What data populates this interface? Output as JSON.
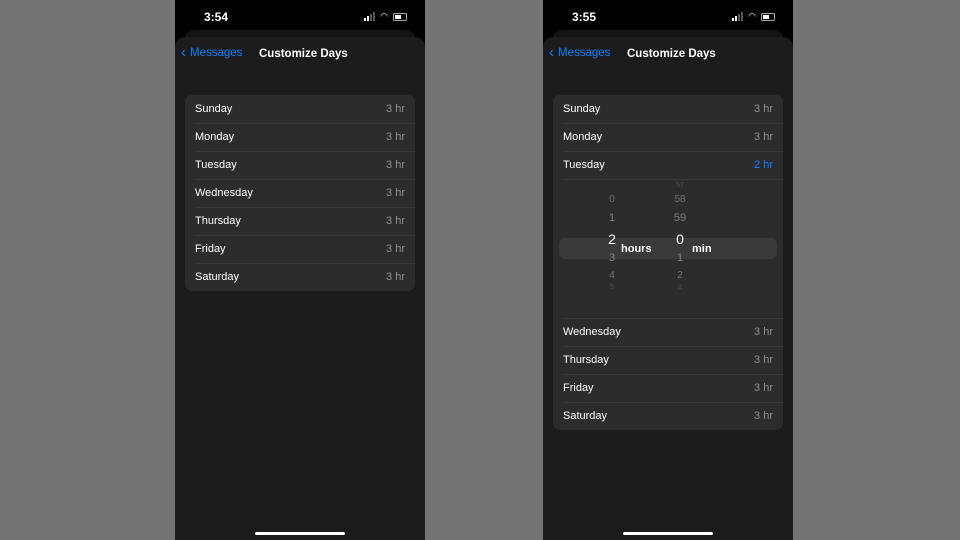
{
  "nav": {
    "back_label": "Messages",
    "title": "Customize Days"
  },
  "left": {
    "time": "3:54",
    "days": [
      {
        "day": "Sunday",
        "value": "3 hr"
      },
      {
        "day": "Monday",
        "value": "3 hr"
      },
      {
        "day": "Tuesday",
        "value": "3 hr"
      },
      {
        "day": "Wednesday",
        "value": "3 hr"
      },
      {
        "day": "Thursday",
        "value": "3 hr"
      },
      {
        "day": "Friday",
        "value": "3 hr"
      },
      {
        "day": "Saturday",
        "value": "3 hr"
      }
    ]
  },
  "right": {
    "time": "3:55",
    "days": [
      {
        "day": "Sunday",
        "value": "3 hr"
      },
      {
        "day": "Monday",
        "value": "3 hr"
      },
      {
        "day": "Tuesday",
        "value": "2 hr"
      },
      {
        "day": "Wednesday",
        "value": "3 hr"
      },
      {
        "day": "Thursday",
        "value": "3 hr"
      },
      {
        "day": "Friday",
        "value": "3 hr"
      },
      {
        "day": "Saturday",
        "value": "3 hr"
      }
    ],
    "picker": {
      "hours": [
        "0",
        "1",
        "2",
        "3",
        "4",
        "5"
      ],
      "hours_unit": "hours",
      "minutes": [
        "57",
        "58",
        "59",
        "0",
        "1",
        "2",
        "3"
      ],
      "minutes_unit": "min",
      "selected_hours": "2",
      "selected_minutes": "0"
    }
  },
  "colors": {
    "accent": "#0a84ff",
    "background": "#1c1c1e",
    "cell": "#2c2c2e"
  }
}
